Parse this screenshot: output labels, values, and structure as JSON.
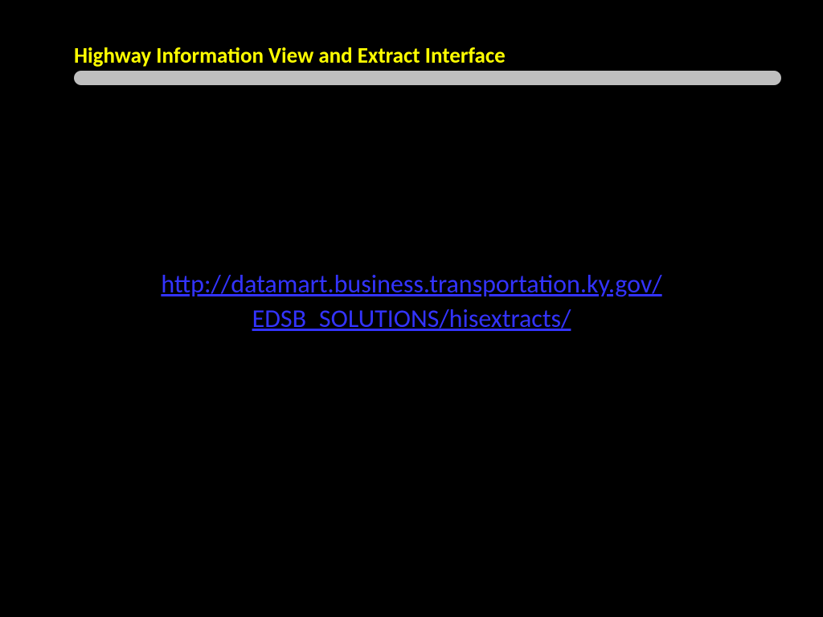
{
  "slide": {
    "title": "Highway Information View and Extract Interface",
    "link_line1": "http://datamart.business.transportation.ky.gov/",
    "link_line2": "EDSB_SOLUTIONS/hisextracts/"
  }
}
